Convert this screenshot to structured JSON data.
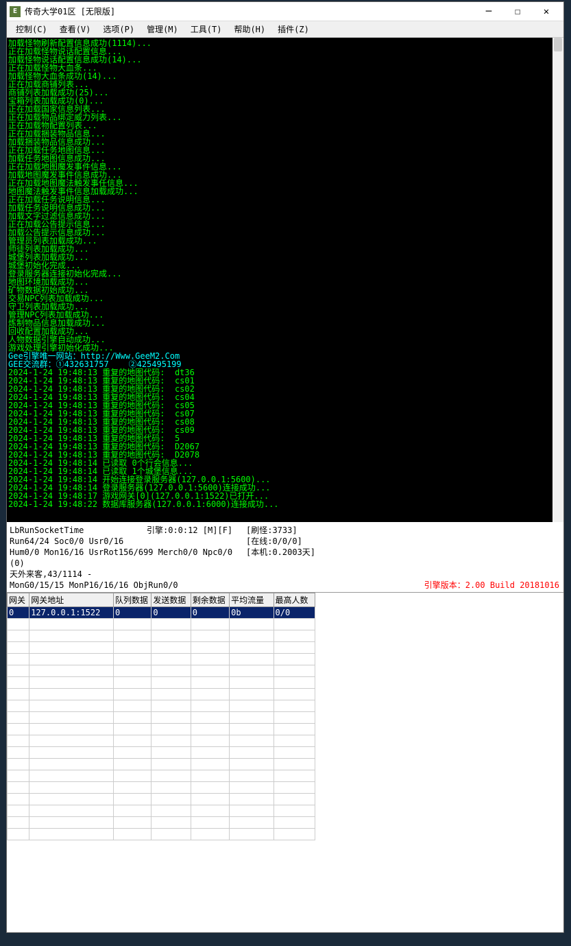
{
  "window": {
    "title": "传奇大学01区  [无限版]",
    "icon_letter": "E"
  },
  "menu": {
    "control": "控制(C)",
    "view": "查看(V)",
    "options": "选项(P)",
    "manage": "管理(M)",
    "tools": "工具(T)",
    "help": "帮助(H)",
    "plugins": "插件(Z)"
  },
  "console_lines": [
    {
      "t": "加载怪物刷新配置信息成功(1114)...",
      "c": "g"
    },
    {
      "t": "正在加载怪物说话配置信息...",
      "c": "g"
    },
    {
      "t": "加载怪物说话配置信息成功(14)...",
      "c": "g"
    },
    {
      "t": "正在加载怪物大血条...",
      "c": "g"
    },
    {
      "t": "加载怪物大血条成功(14)...",
      "c": "g"
    },
    {
      "t": "正在加载商铺列表...",
      "c": "g"
    },
    {
      "t": "商铺列表加载成功(25)...",
      "c": "g"
    },
    {
      "t": "宝箱列表加载成功(0)...",
      "c": "g"
    },
    {
      "t": "正在加载国家信息列表...",
      "c": "g"
    },
    {
      "t": "正在加载物品绑定威力列表...",
      "c": "g"
    },
    {
      "t": "正在加载物配置列表...",
      "c": "g"
    },
    {
      "t": "正在加载捆装物品信息...",
      "c": "g"
    },
    {
      "t": "加载捆装物品信息成功...",
      "c": "g"
    },
    {
      "t": "正在加载任务地图信息...",
      "c": "g"
    },
    {
      "t": "加载任务地图信息成功...",
      "c": "g"
    },
    {
      "t": "正在加载地图魔发事件信息...",
      "c": "g"
    },
    {
      "t": "加载地图魔发事件信息成功...",
      "c": "g"
    },
    {
      "t": "正在加载地图魔法触发事任信息...",
      "c": "g"
    },
    {
      "t": "地图魔法触发事件信息加载成功...",
      "c": "g"
    },
    {
      "t": "正在加载任务说明信息...",
      "c": "g"
    },
    {
      "t": "加载任务说明信息成功...",
      "c": "g"
    },
    {
      "t": "加载文字过滤信息成功...",
      "c": "g"
    },
    {
      "t": "正在加载公告提示信息...",
      "c": "g"
    },
    {
      "t": "加载公告提示信息成功...",
      "c": "g"
    },
    {
      "t": "管理员列表加载成功...",
      "c": "g"
    },
    {
      "t": "师徒列表加载成功...",
      "c": "g"
    },
    {
      "t": "城堡列表加载成功...",
      "c": "g"
    },
    {
      "t": "城堡初始化完成...",
      "c": "g"
    },
    {
      "t": "登录服务器连接初始化完成...",
      "c": "g"
    },
    {
      "t": "地图环境加载成功...",
      "c": "g"
    },
    {
      "t": "矿物数据初始成功...",
      "c": "g"
    },
    {
      "t": "交易NPC列表加载成功...",
      "c": "g"
    },
    {
      "t": "守卫列表加载成功...",
      "c": "g"
    },
    {
      "t": "管理NPC列表加载成功...",
      "c": "g"
    },
    {
      "t": "炼制物品信息加载成功...",
      "c": "g"
    },
    {
      "t": "回收配置加载成功...",
      "c": "g"
    },
    {
      "t": "人物数据引擎自动成功...",
      "c": "g"
    },
    {
      "t": "游戏处理引擎初始化成功...",
      "c": "g"
    },
    {
      "t": "Gee引擎唯一网站：http://Www.GeeM2.Com",
      "c": "c"
    },
    {
      "t": "GEE交流群：①432631757    ②425495199",
      "c": "c"
    },
    {
      "t": "2024-1-24 19:48:13 重复的地图代码:  dt36",
      "c": "g"
    },
    {
      "t": "2024-1-24 19:48:13 重复的地图代码:  cs01",
      "c": "g"
    },
    {
      "t": "2024-1-24 19:48:13 重复的地图代码:  cs02",
      "c": "g"
    },
    {
      "t": "2024-1-24 19:48:13 重复的地图代码:  cs04",
      "c": "g"
    },
    {
      "t": "2024-1-24 19:48:13 重复的地图代码:  cs05",
      "c": "g"
    },
    {
      "t": "2024-1-24 19:48:13 重复的地图代码:  cs07",
      "c": "g"
    },
    {
      "t": "2024-1-24 19:48:13 重复的地图代码:  cs08",
      "c": "g"
    },
    {
      "t": "2024-1-24 19:48:13 重复的地图代码:  cs09",
      "c": "g"
    },
    {
      "t": "2024-1-24 19:48:13 重复的地图代码:  5",
      "c": "g"
    },
    {
      "t": "2024-1-24 19:48:13 重复的地图代码:  D2067",
      "c": "g"
    },
    {
      "t": "2024-1-24 19:48:13 重复的地图代码:  D2078",
      "c": "g"
    },
    {
      "t": "2024-1-24 19:48:14 已读取 0个行会信息...",
      "c": "g"
    },
    {
      "t": "2024-1-24 19:48:14 已读取 1个城堡信息...",
      "c": "g"
    },
    {
      "t": "2024-1-24 19:48:14 开始连接登录服务器(127.0.0.1:5600)...",
      "c": "g"
    },
    {
      "t": "2024-1-24 19:48:14 登录服务器(127.0.0.1:5600)连接成功...",
      "c": "g"
    },
    {
      "t": "2024-1-24 19:48:17 游戏网关[0](127.0.0.1:1522)已打开...",
      "c": "g"
    },
    {
      "t": "2024-1-24 19:48:22 数据库服务器(127.0.0.1:6000)连接成功...",
      "c": "g"
    }
  ],
  "status": {
    "row1_left": "LbRunSocketTime",
    "row1_mid": "引擎:0:0:12 [M][F]",
    "row1_right": "[刷怪:3733]",
    "row2_left": "Run64/24 Soc0/0 Usr0/16",
    "row2_right": "[在线:0/0/0]",
    "row3_left": "Hum0/0 Mon16/16 UsrRot156/699 Merch0/0 Npc0/0 (0)",
    "row3_right": "[本机:0.2003天]",
    "row4_left": "天外来客,43/1114 -",
    "row5_left": "MonG0/15/15 MonP16/16/16 ObjRun0/0",
    "engine_version": "引擎版本：2.00 Build 20181016"
  },
  "table": {
    "headers": {
      "gateway": "网关",
      "address": "网关地址",
      "queue": "队列数据",
      "send": "发送数据",
      "remain": "剩余数据",
      "avg": "平均流量",
      "max": "最高人数"
    },
    "rows": [
      {
        "gateway": "0",
        "address": "127.0.0.1:1522",
        "queue": "0",
        "send": "0",
        "remain": "0",
        "avg": "0b",
        "max": "0/0"
      }
    ],
    "empty_rows": 19
  }
}
